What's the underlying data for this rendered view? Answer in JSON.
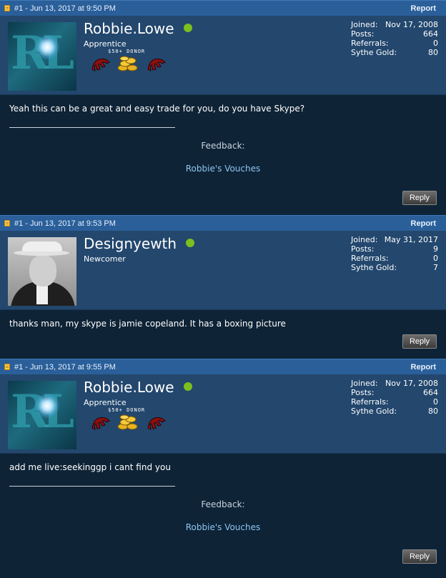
{
  "posts": [
    {
      "header": {
        "date": "#1 - Jun 13, 2017 at 9:50 PM",
        "report": "Report"
      },
      "user": {
        "name": "Robbie.Lowe",
        "title": "Apprentice",
        "donor": "$50+ DONOR",
        "stats": [
          {
            "label": "Joined:",
            "value": "Nov 17, 2008"
          },
          {
            "label": "Posts:",
            "value": "664"
          },
          {
            "label": "Referrals:",
            "value": "0"
          },
          {
            "label": "Sythe Gold:",
            "value": "80"
          }
        ]
      },
      "message": "Yeah this can be a great and easy trade for you, do you have Skype?",
      "feedback_label": "Feedback:",
      "vouches_link": "Robbie's Vouches",
      "reply": "Reply"
    },
    {
      "header": {
        "date": "#1 - Jun 13, 2017 at 9:53 PM",
        "report": "Report"
      },
      "user": {
        "name": "Designyewth",
        "title": "Newcomer",
        "stats": [
          {
            "label": "Joined:",
            "value": "May 31, 2017"
          },
          {
            "label": "Posts:",
            "value": "9"
          },
          {
            "label": "Referrals:",
            "value": "0"
          },
          {
            "label": "Sythe Gold:",
            "value": "7"
          }
        ]
      },
      "message": "thanks man, my skype is jamie copeland. It has a boxing picture",
      "reply": "Reply"
    },
    {
      "header": {
        "date": "#1 - Jun 13, 2017 at 9:55 PM",
        "report": "Report"
      },
      "user": {
        "name": "Robbie.Lowe",
        "title": "Apprentice",
        "donor": "$50+ DONOR",
        "stats": [
          {
            "label": "Joined:",
            "value": "Nov 17, 2008"
          },
          {
            "label": "Posts:",
            "value": "664"
          },
          {
            "label": "Referrals:",
            "value": "0"
          },
          {
            "label": "Sythe Gold:",
            "value": "80"
          }
        ]
      },
      "message": "add me live:seekinggp i cant find you",
      "feedback_label": "Feedback:",
      "vouches_link": "Robbie's Vouches",
      "reply": "Reply"
    }
  ],
  "colors": {
    "header_bar": "#2a5f9a",
    "userinfo_bg": "#23476d",
    "page_bg": "#0e2336",
    "online_dot": "#7cbf1e",
    "link": "#8ec5f1"
  }
}
